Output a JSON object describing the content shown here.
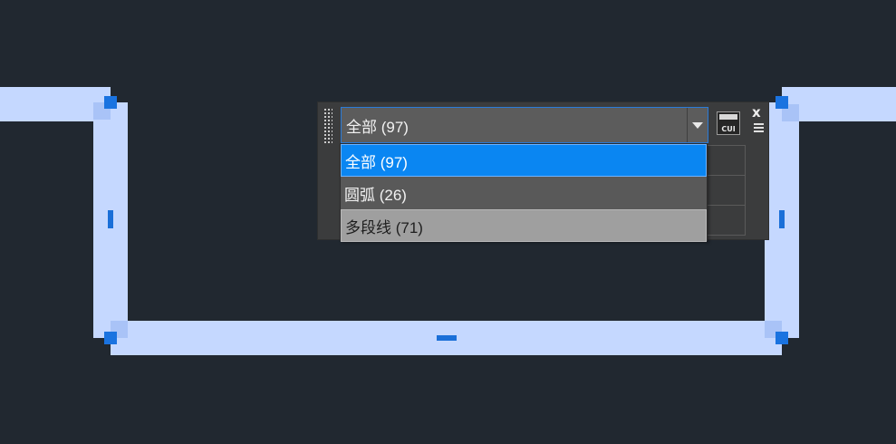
{
  "palette": {
    "combo_value": "全部 (97)",
    "cui_label": "CUI",
    "close_label": "x",
    "options": [
      {
        "label": "全部 (97)",
        "state": "selected"
      },
      {
        "label": "圆弧 (26)",
        "state": "normal"
      },
      {
        "label": "多段线 (71)",
        "state": "hover"
      }
    ]
  },
  "colors": {
    "canvas_bg": "#212830",
    "selection_band": "#c5d8ff",
    "grip": "#1a73e0",
    "list_selected": "#0a86f2"
  },
  "icons": [
    "drag-handle-icon",
    "dropdown-arrow-icon",
    "cui-icon",
    "close-icon",
    "menu-icon"
  ]
}
